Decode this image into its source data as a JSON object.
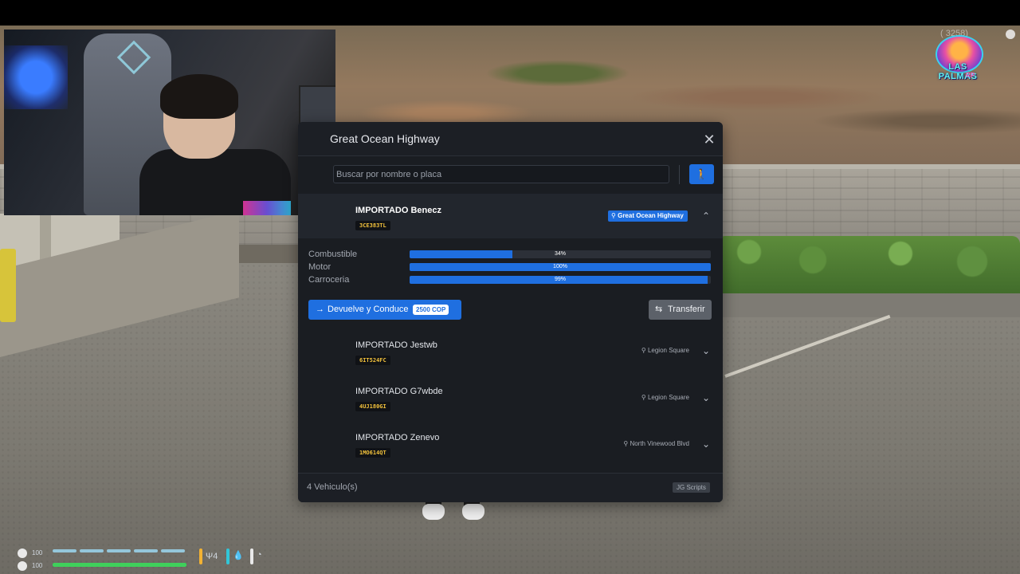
{
  "hud_overlay": {
    "player_id": "( 3258)",
    "logo": {
      "name": "LAS PALMAS",
      "sub": "RP"
    }
  },
  "garage": {
    "title": "Great Ocean Highway",
    "search_placeholder": "Buscar por nombre o placa",
    "walk_button": "🚶",
    "vehicles": [
      {
        "name": "IMPORTADO Benecz",
        "plate": "3CE383TL",
        "location": "Great Ocean Highway",
        "expanded": true
      },
      {
        "name": "IMPORTADO Jestwb",
        "plate": "6IT524FC",
        "location": "Legion Square",
        "expanded": false
      },
      {
        "name": "IMPORTADO G7wbde",
        "plate": "4UJ180GI",
        "location": "Legion Square",
        "expanded": false
      },
      {
        "name": "IMPORTADO Zenevo",
        "plate": "1MO614QT",
        "location": "North Vinewood Blvd",
        "expanded": false
      }
    ],
    "stats": [
      {
        "label": "Combustible",
        "value": 34,
        "text": "34%"
      },
      {
        "label": "Motor",
        "value": 100,
        "text": "100%"
      },
      {
        "label": "Carroceria",
        "value": 99,
        "text": "99%"
      }
    ],
    "drive_button": {
      "arrow": "→",
      "label": "Devuelve y Conduce",
      "cost": "2500 COP"
    },
    "transfer_button": {
      "icon": "⇆",
      "label": "Transferir"
    },
    "footer": {
      "count": "4 Vehiculo(s)",
      "brand": "JG Scripts"
    }
  },
  "player_hud": {
    "armor": "100",
    "health": "100",
    "health_fraction": 1.0,
    "extra": "Ψ4",
    "colors": {
      "armor": "#9bd7f0",
      "health": "#3fd05b",
      "accent": "#1f6fe0",
      "plate_text": "#f3c23c"
    }
  }
}
